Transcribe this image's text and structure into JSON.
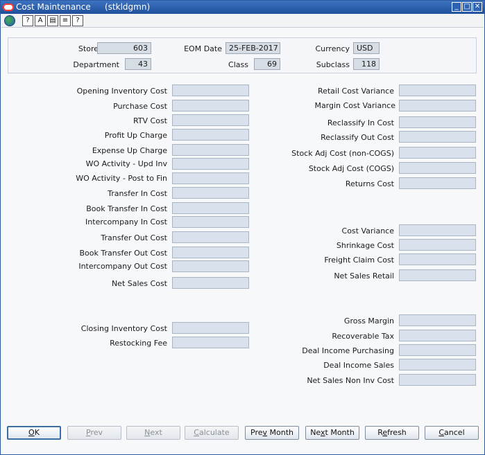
{
  "window": {
    "title": "Cost Maintenance",
    "subtitle": "(stkldgmn)",
    "minimize_icon": "minimize-icon",
    "maximize_icon": "maximize-icon",
    "close_icon": "close-icon"
  },
  "toolbar": {
    "icons": [
      "globe-icon",
      "help-topics-icon",
      "help-search-icon",
      "help-book-icon",
      "help-index-icon",
      "help-question-icon"
    ]
  },
  "header": {
    "store_label": "Store",
    "store_value": "603",
    "eom_date_label": "EOM Date",
    "eom_date_value": "25-FEB-2017",
    "currency_label": "Currency",
    "currency_value": "USD",
    "department_label": "Department",
    "department_value": "43",
    "class_label": "Class",
    "class_value": "69",
    "subclass_label": "Subclass",
    "subclass_value": "118"
  },
  "left_fields": [
    {
      "label": "Opening Inventory Cost",
      "value": ""
    },
    {
      "label": "Purchase Cost",
      "value": ""
    },
    {
      "label": "RTV Cost",
      "value": ""
    },
    {
      "label": "Profit Up Charge",
      "value": ""
    },
    {
      "label": "Expense Up Charge",
      "value": ""
    },
    {
      "label": "WO Activity - Upd Inv",
      "value": ""
    },
    {
      "label": "WO Activity - Post to Fin",
      "value": ""
    },
    {
      "label": "Transfer In Cost",
      "value": ""
    },
    {
      "label": "Book Transfer In Cost",
      "value": ""
    },
    {
      "label": "Intercompany In Cost",
      "value": ""
    },
    {
      "label": "Transfer Out Cost",
      "value": ""
    },
    {
      "label": "Book Transfer Out Cost",
      "value": ""
    },
    {
      "label": "Intercompany Out Cost",
      "value": ""
    },
    {
      "label": "Net Sales Cost",
      "value": ""
    },
    {
      "label": "Closing Inventory Cost",
      "value": ""
    },
    {
      "label": "Restocking Fee",
      "value": ""
    }
  ],
  "right_fields": [
    {
      "label": "Retail Cost Variance",
      "value": ""
    },
    {
      "label": "Margin Cost Variance",
      "value": ""
    },
    {
      "label": "Reclassify In Cost",
      "value": ""
    },
    {
      "label": "Reclassify Out Cost",
      "value": ""
    },
    {
      "label": "Stock Adj Cost (non-COGS)",
      "value": ""
    },
    {
      "label": "Stock Adj Cost (COGS)",
      "value": ""
    },
    {
      "label": "Returns Cost",
      "value": ""
    },
    {
      "label": "Cost Variance",
      "value": ""
    },
    {
      "label": "Shrinkage Cost",
      "value": ""
    },
    {
      "label": "Freight Claim Cost",
      "value": ""
    },
    {
      "label": "Net Sales Retail",
      "value": ""
    },
    {
      "label": "Gross Margin",
      "value": ""
    },
    {
      "label": "Recoverable Tax",
      "value": ""
    },
    {
      "label": "Deal Income Purchasing",
      "value": ""
    },
    {
      "label": "Deal Income Sales",
      "value": ""
    },
    {
      "label": "Net Sales Non Inv Cost",
      "value": ""
    }
  ],
  "buttons": {
    "ok": {
      "mnemonic": "O",
      "rest": "K"
    },
    "prev": {
      "mnemonic": "P",
      "rest": "rev"
    },
    "next": {
      "mnemonic": "N",
      "rest": "ext"
    },
    "calculate": {
      "mnemonic": "C",
      "rest": "alculate"
    },
    "prev_month": {
      "pre": "Pre",
      "mnemonic": "v",
      "rest": " Month"
    },
    "next_month": {
      "pre": "Ne",
      "mnemonic": "x",
      "rest": "t Month"
    },
    "refresh": {
      "pre": "R",
      "mnemonic": "e",
      "rest": "fresh"
    },
    "cancel": {
      "mnemonic": "C",
      "rest": "ancel"
    }
  },
  "colors": {
    "titlebar": "#1f4f9c",
    "field_bg": "#d8e1ec",
    "readonly_bg": "#d7dde5"
  }
}
